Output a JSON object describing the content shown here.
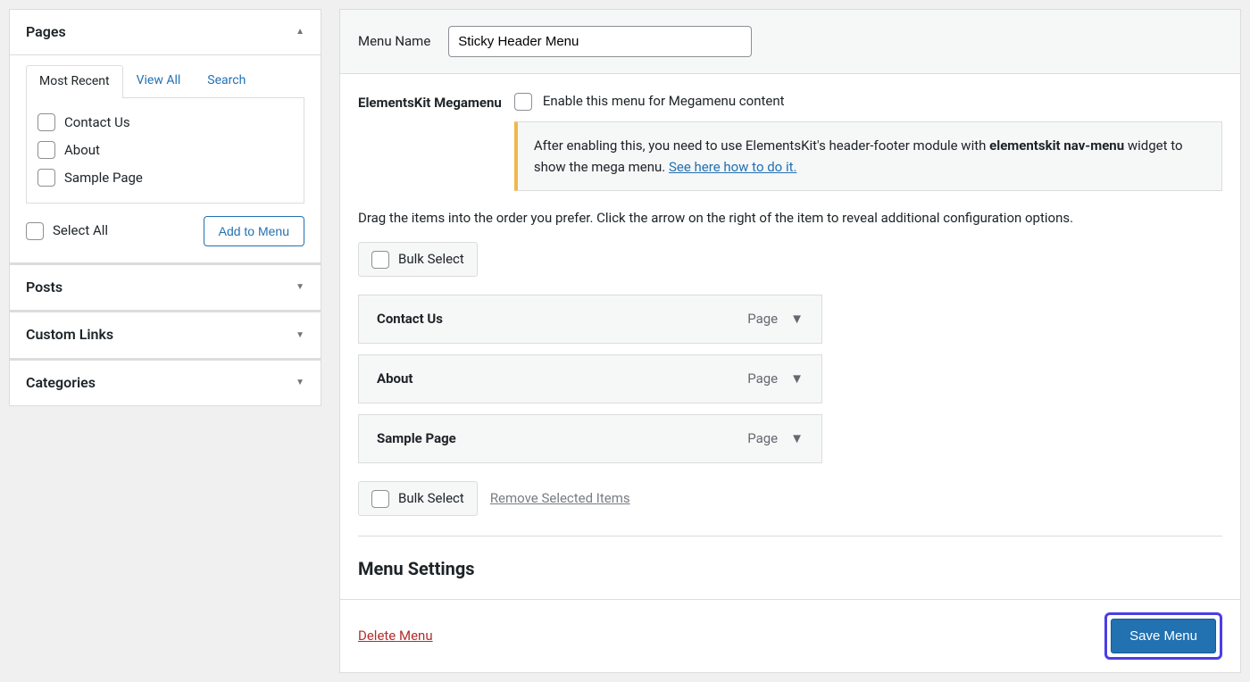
{
  "sidebar": {
    "pages": {
      "title": "Pages",
      "tabs": {
        "recent": "Most Recent",
        "all": "View All",
        "search": "Search"
      },
      "items": [
        "Contact Us",
        "About",
        "Sample Page"
      ],
      "select_all": "Select All",
      "add_btn": "Add to Menu"
    },
    "posts": "Posts",
    "custom_links": "Custom Links",
    "categories": "Categories"
  },
  "main": {
    "menu_name_label": "Menu Name",
    "menu_name_value": "Sticky Header Menu",
    "megamenu_label": "ElementsKit Megamenu",
    "enable_label": "Enable this menu for Megamenu content",
    "notice_pre": "After enabling this, you need to use ElementsKit's header-footer module with ",
    "notice_strong": "elementskit nav-menu",
    "notice_mid": " widget to show the mega menu. ",
    "notice_link": "See here how to do it.",
    "instructions": "Drag the items into the order you prefer. Click the arrow on the right of the item to reveal additional configuration options.",
    "bulk_select": "Bulk Select",
    "items": [
      {
        "title": "Contact Us",
        "type": "Page"
      },
      {
        "title": "About",
        "type": "Page"
      },
      {
        "title": "Sample Page",
        "type": "Page"
      }
    ],
    "remove_selected": "Remove Selected Items",
    "settings_heading": "Menu Settings",
    "delete_menu": "Delete Menu",
    "save_menu": "Save Menu"
  }
}
